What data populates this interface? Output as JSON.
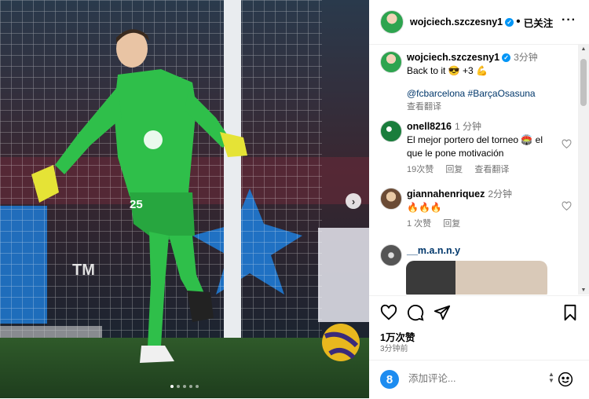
{
  "post": {
    "author": "wojciech.szczesny1",
    "follow_label": "已关注",
    "more_label": "···"
  },
  "caption": {
    "author": "wojciech.szczesny1",
    "time": "3分钟",
    "text": "Back to it 😎 +3 💪",
    "tags": "@fcbarcelona #BarçaOsasuna",
    "translate": "查看翻译"
  },
  "comments": [
    {
      "user": "onell8216",
      "time": "1 分钟",
      "text": "El mejor portero del torneo 🏟️ el que le pone motivación",
      "likes": "19次赞",
      "reply": "回复",
      "translate": "查看翻译"
    },
    {
      "user": "giannahenriquez",
      "time": "2分钟",
      "text": "🔥🔥🔥",
      "likes": "1 次赞",
      "reply": "回复"
    },
    {
      "user": "__m.a.n.n.y"
    }
  ],
  "photo": {
    "jersey_number": "25",
    "sponsor_text": "TM",
    "carousel_total": 5,
    "carousel_active": 1
  },
  "actions": {
    "likes": "1万次赞",
    "ago": "3分钟前"
  },
  "composer": {
    "placeholder": "添加评论..."
  },
  "colors": {
    "verified": "#0095f6",
    "link": "#00376b",
    "muted": "#737373",
    "kit": "#2fbf4a"
  }
}
